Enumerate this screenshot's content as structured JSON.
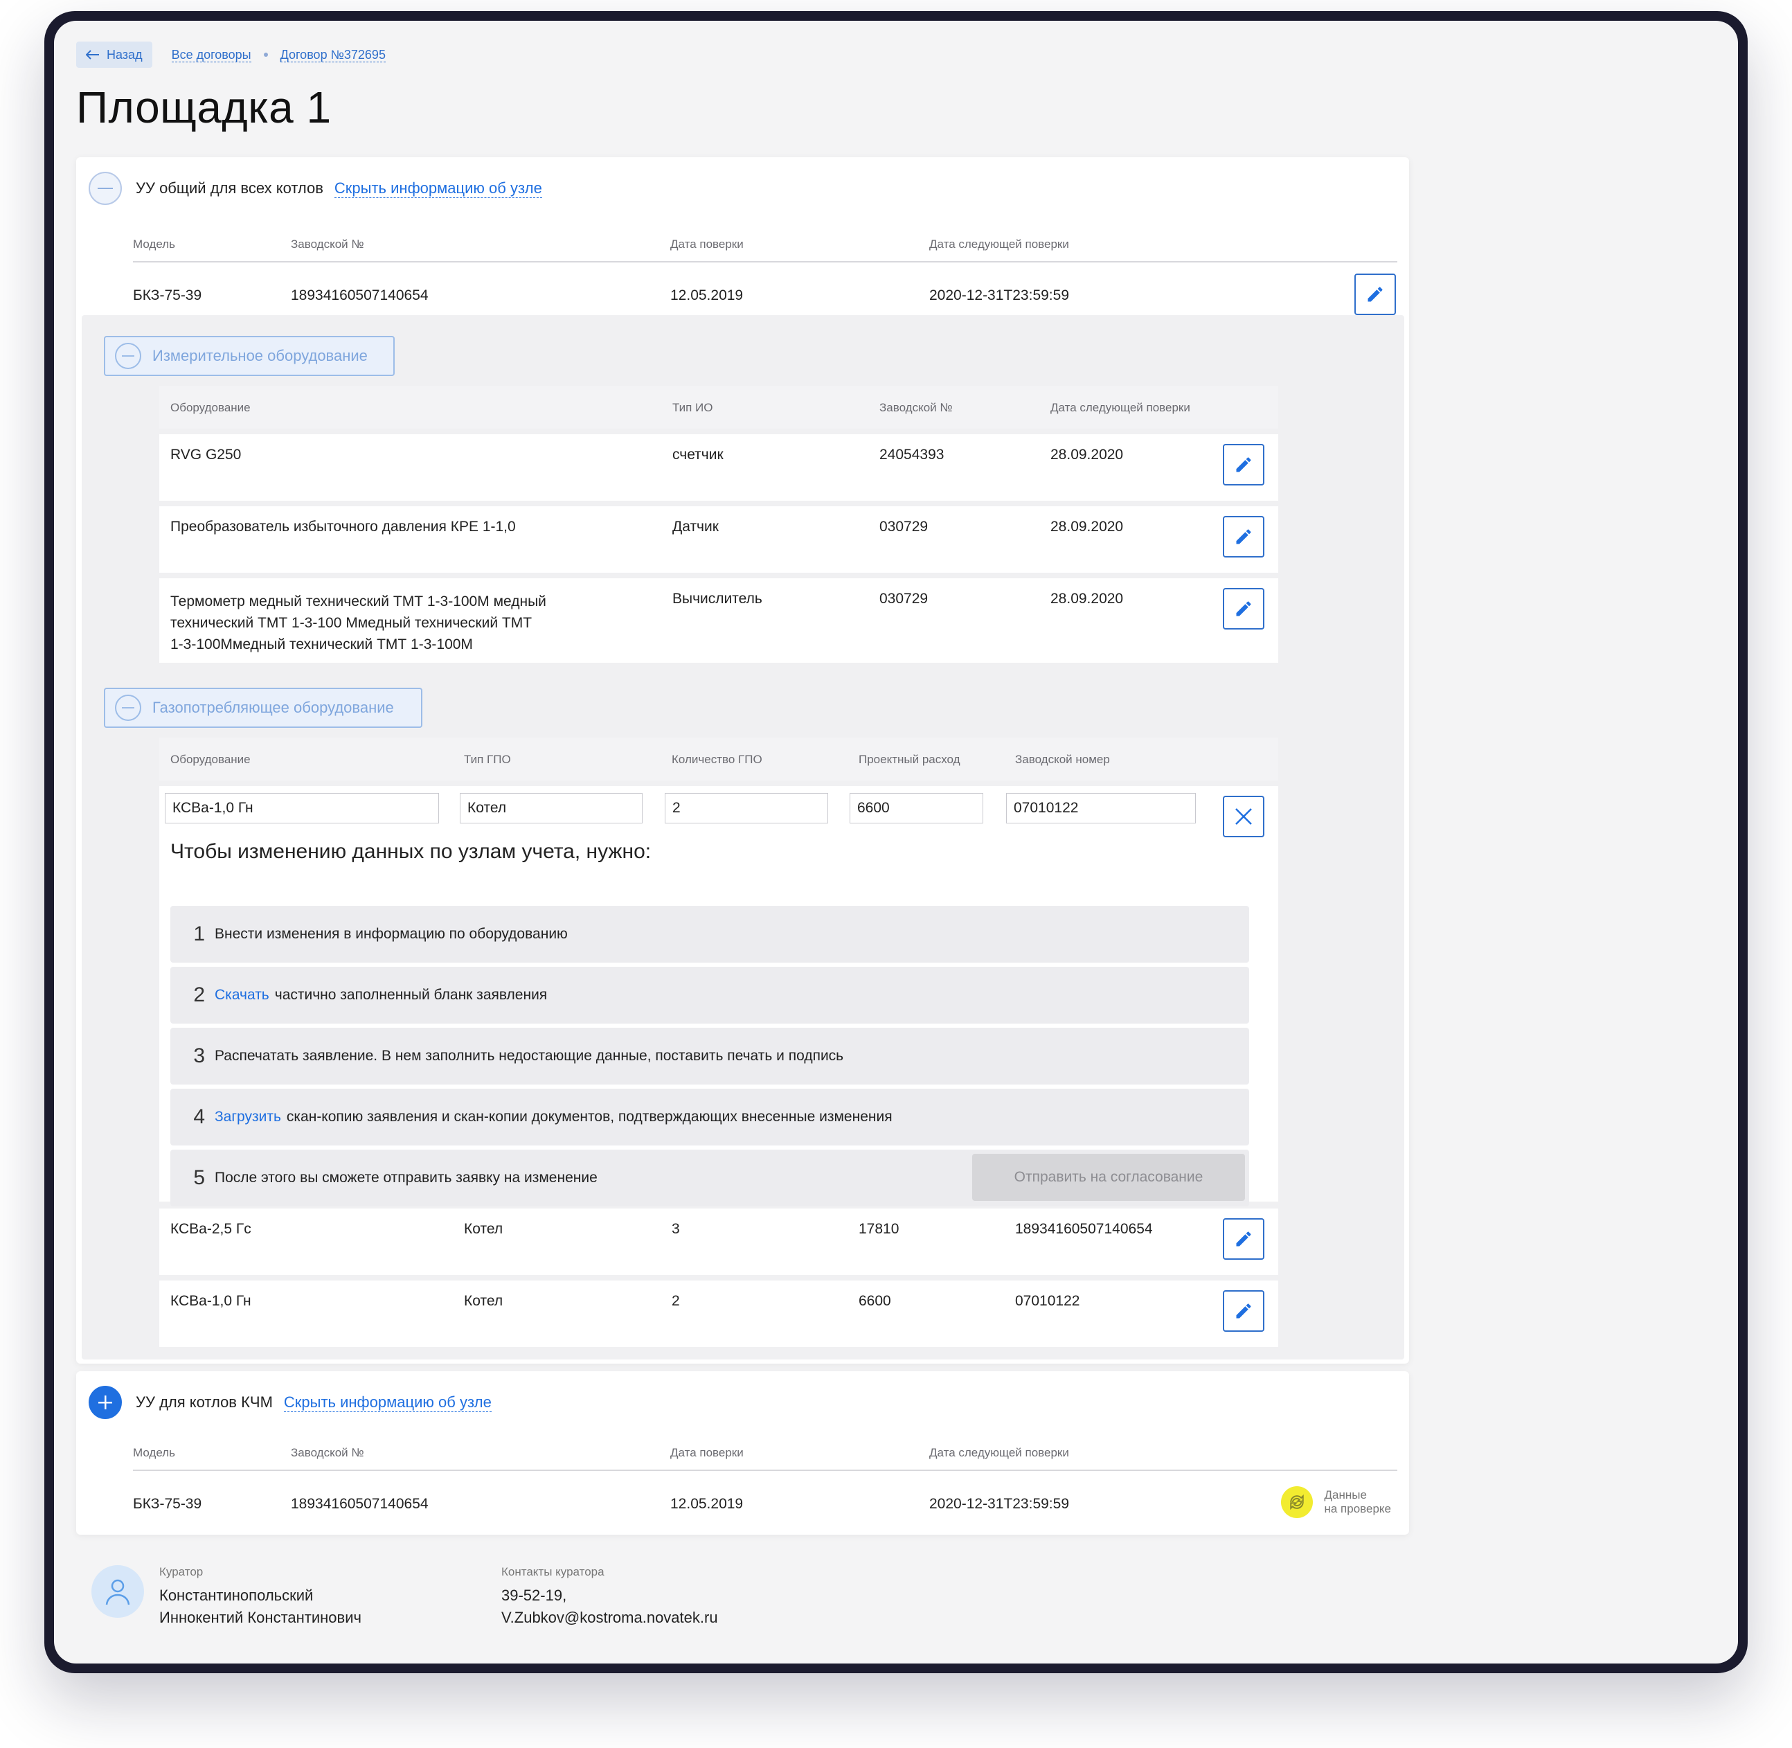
{
  "breadcrumb": {
    "back": "Назад",
    "all_contracts": "Все договоры",
    "contract": "Договор №372695"
  },
  "page_title": "Площадка 1",
  "node1": {
    "title": "УУ общий для всех котлов",
    "toggle_link": "Скрыть информацию об узле",
    "headers": {
      "model": "Модель",
      "serial": "Заводской №",
      "check_date": "Дата поверки",
      "next_check": "Дата следующей поверки"
    },
    "row": {
      "model": "БКЗ-75-39",
      "serial": "18934160507140654",
      "check_date": "12.05.2019",
      "next_check": "2020-12-31T23:59:59"
    }
  },
  "measuring": {
    "section_label": "Измерительное оборудование",
    "headers": {
      "equipment": "Оборудование",
      "type": "Тип ИО",
      "serial": "Заводской №",
      "next_check": "Дата следующей поверки"
    },
    "rows": [
      {
        "equipment": "RVG G250",
        "equipment_line2": "",
        "equipment_line3": "",
        "type": "счетчик",
        "serial": "24054393",
        "next_check": "28.09.2020"
      },
      {
        "equipment": "Преобразователь избыточного давления КРЕ 1-1,0",
        "equipment_line2": "",
        "equipment_line3": "",
        "type": "Датчик",
        "serial": "030729",
        "next_check": "28.09.2020"
      },
      {
        "equipment": "Термометр медный технический ТМТ 1-3-100М медный",
        "equipment_line2": "технический ТМТ 1-3-100 Ммедный технический ТМТ",
        "equipment_line3": "1-3-100Ммедный технический ТМТ 1-3-100М",
        "type": "Вычислитель",
        "serial": "030729",
        "next_check": "28.09.2020"
      }
    ]
  },
  "gas": {
    "section_label": "Газопотребляющее оборудование",
    "headers": {
      "equipment": "Оборудование",
      "type": "Тип ГПО",
      "count": "Количество ГПО",
      "flow": "Проектный расход",
      "serial": "Заводской номер"
    },
    "edit_row": {
      "equipment": "КСВа-1,0 Гн",
      "type": "Котел",
      "count": "2",
      "flow": "6600",
      "serial": "07010122"
    },
    "instructions": {
      "title": "Чтобы изменению данных по узлам учета, нужно:",
      "steps": [
        {
          "num": "1",
          "link": "",
          "text": "Внести изменения в информацию по оборудованию"
        },
        {
          "num": "2",
          "link": "Скачать",
          "text": "частично заполненный бланк заявления"
        },
        {
          "num": "3",
          "link": "",
          "text": "Распечатать заявление. В нем заполнить недостающие данные, поставить печать и подпись"
        },
        {
          "num": "4",
          "link": "Загрузить",
          "text": "скан-копию заявления и скан-копии документов, подтверждающих внесенные изменения"
        },
        {
          "num": "5",
          "link": "",
          "text": "После этого вы сможете отправить заявку на изменение"
        }
      ],
      "submit_label": "Отправить на согласование"
    },
    "rows": [
      {
        "equipment": "КСВа-2,5 Гс",
        "type": "Котел",
        "count": "3",
        "flow": "17810",
        "serial": "18934160507140654"
      },
      {
        "equipment": "КСВа-1,0 Гн",
        "type": "Котел",
        "count": "2",
        "flow": "6600",
        "serial": "07010122"
      }
    ]
  },
  "node2": {
    "title": "УУ для котлов КЧМ",
    "toggle_link": "Скрыть информацию об узле",
    "headers": {
      "model": "Модель",
      "serial": "Заводской №",
      "check_date": "Дата поверки",
      "next_check": "Дата следующей поверки"
    },
    "row": {
      "model": "БКЗ-75-39",
      "serial": "18934160507140654",
      "check_date": "12.05.2019",
      "next_check": "2020-12-31T23:59:59"
    },
    "status_line1": "Данные",
    "status_line2": "на проверке"
  },
  "curator": {
    "label": "Куратор",
    "name_line1": "Константинопольский",
    "name_line2": "Иннокентий Константинович",
    "contacts_label": "Контакты куратора",
    "phone": "39-52-19,",
    "email": "V.Zubkov@kostroma.novatek.ru"
  },
  "colors": {
    "accent": "#1f6fe0",
    "status_yellow": "#f2ec30"
  },
  "icons": [
    "arrow-left-icon",
    "minus-icon",
    "plus-icon",
    "pencil-icon",
    "close-icon",
    "refresh-icon",
    "user-icon"
  ]
}
